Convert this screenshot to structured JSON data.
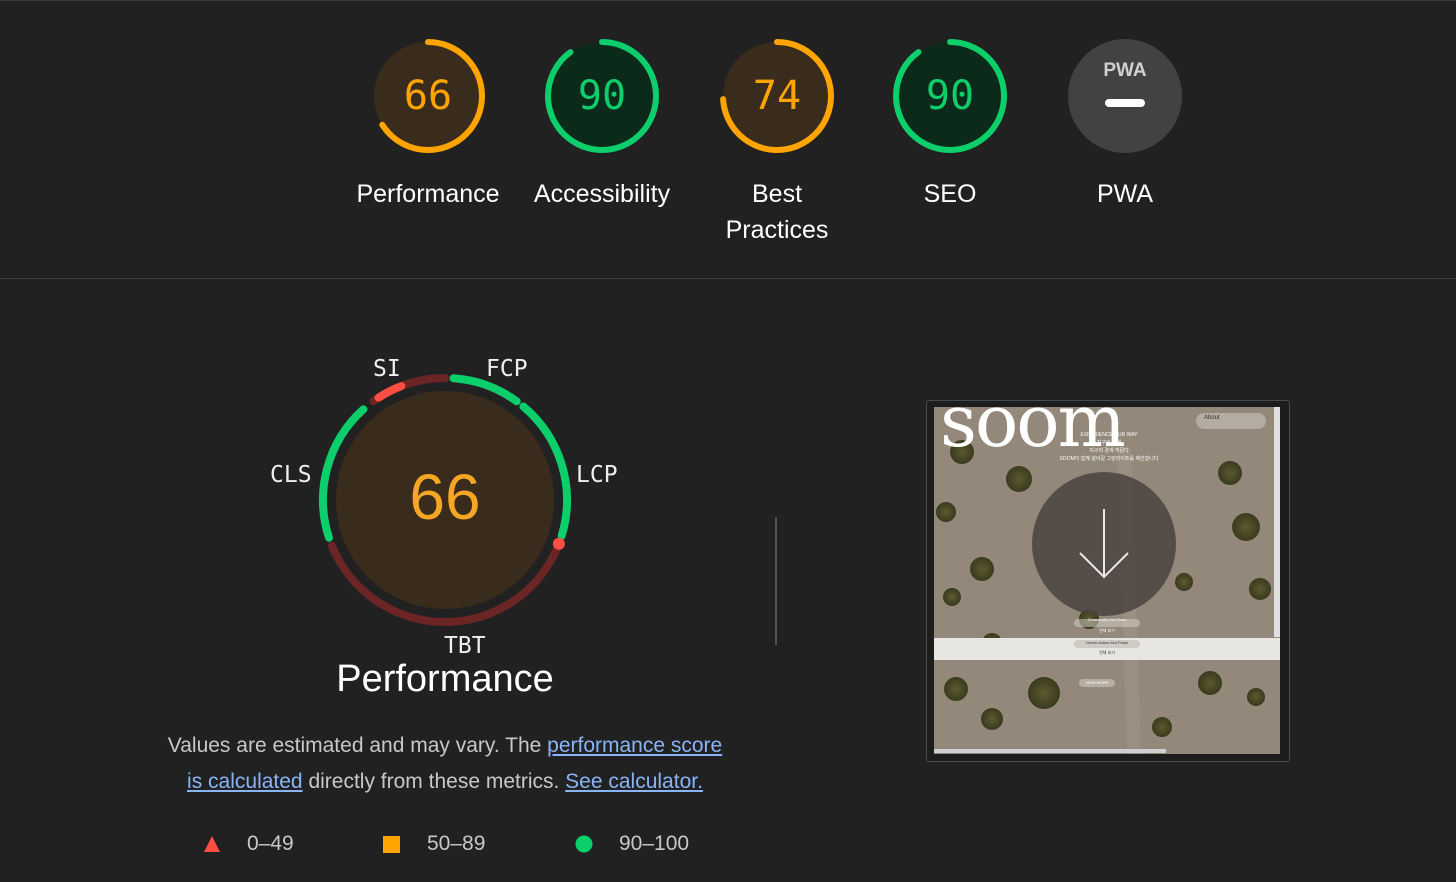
{
  "categories": [
    {
      "id": "performance",
      "label": "Performance",
      "score": "66",
      "fraction": 0.66,
      "status": "average"
    },
    {
      "id": "accessibility",
      "label": "Accessibility",
      "score": "90",
      "fraction": 0.9,
      "status": "pass"
    },
    {
      "id": "best-practices",
      "label": "Best Practices",
      "score": "74",
      "fraction": 0.74,
      "status": "average"
    },
    {
      "id": "seo",
      "label": "SEO",
      "score": "90",
      "fraction": 0.9,
      "status": "pass"
    },
    {
      "id": "pwa",
      "label": "PWA",
      "score": "",
      "badge": "PWA",
      "status": "na"
    }
  ],
  "colors": {
    "pass": "#0cce6b",
    "average": "#ffa400",
    "fail": "#ff4e42",
    "pass_bg": "#0c2a1a",
    "average_bg": "#3a2c1c",
    "na_bg": "#424242",
    "score_orange": "#f5a623"
  },
  "performance_detail": {
    "score": "66",
    "title": "Performance",
    "metrics": [
      {
        "name": "SI",
        "status": "fail"
      },
      {
        "name": "FCP",
        "status": "pass"
      },
      {
        "name": "LCP",
        "status": "pass"
      },
      {
        "name": "TBT",
        "status": "fail"
      },
      {
        "name": "CLS",
        "status": "pass"
      }
    ],
    "description": {
      "text_1": "Values are estimated and may vary. The ",
      "link_1a": "performance score",
      "link_1b": "is calculated",
      "text_2": " directly from these metrics. ",
      "link_2": "See calculator."
    },
    "legend": [
      {
        "shape": "triangle",
        "range": "0–49"
      },
      {
        "shape": "square",
        "range": "50–89"
      },
      {
        "shape": "circle",
        "range": "90–100"
      }
    ]
  },
  "screenshot": {
    "brand": "soom",
    "nav_item": "About",
    "headline_lines": [
      "EXPERIENCE OUR WAY",
      "지구의 숨결",
      "지구의 경계 허문다",
      "SOOM이 함께 살아갈 그린라이프를 제안합니다"
    ],
    "buttons": [
      "Community Hot Posts",
      "전체 보기",
      "Green-Action Hot Posts",
      "전체 보기",
      "VIEW MORE"
    ]
  }
}
